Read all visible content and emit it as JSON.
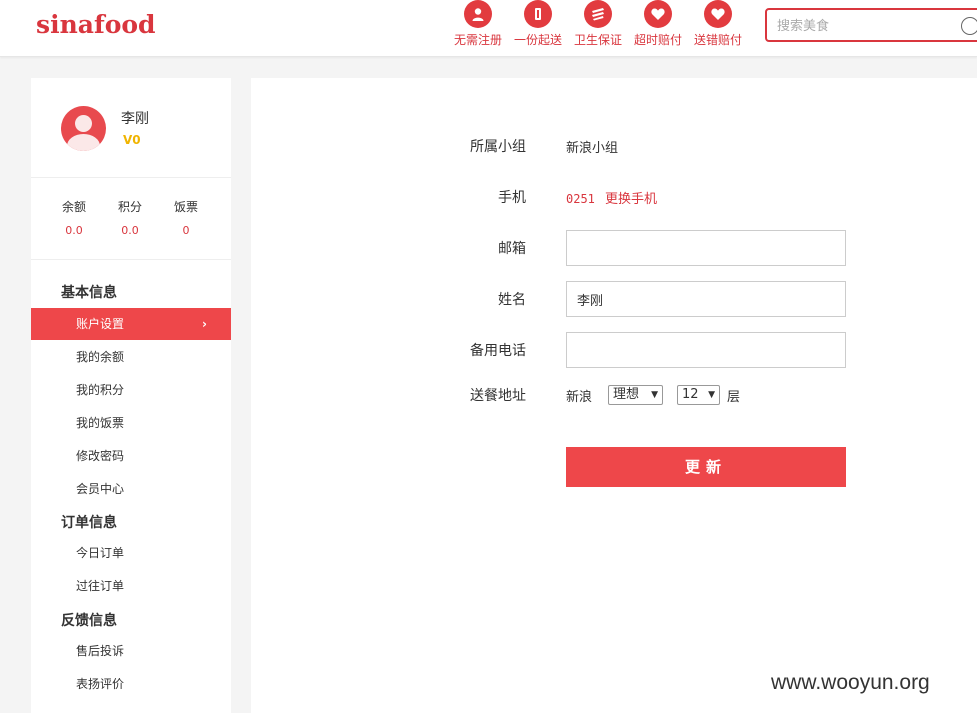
{
  "header": {
    "logo": "sinafood",
    "features": [
      {
        "label": "无需注册",
        "icon": "user-icon"
      },
      {
        "label": "一份起送",
        "icon": "number-one-icon"
      },
      {
        "label": "卫生保证",
        "icon": "hygiene-icon"
      },
      {
        "label": "超时赔付",
        "icon": "heart-icon"
      },
      {
        "label": "送错赔付",
        "icon": "heart-icon"
      }
    ],
    "search": {
      "placeholder": "搜索美食",
      "icon": "search-icon"
    }
  },
  "sidebar": {
    "user": {
      "name": "李刚",
      "vip": "V0"
    },
    "stats": [
      {
        "label": "余额",
        "value": "0.0"
      },
      {
        "label": "积分",
        "value": "0.0"
      },
      {
        "label": "饭票",
        "value": "0"
      }
    ],
    "groups": [
      {
        "title": "基本信息",
        "items": [
          "账户设置",
          "我的余额",
          "我的积分",
          "我的饭票",
          "修改密码",
          "会员中心"
        ]
      },
      {
        "title": "订单信息",
        "items": [
          "今日订单",
          "过往订单"
        ]
      },
      {
        "title": "反馈信息",
        "items": [
          "售后投诉",
          "表扬评价"
        ]
      }
    ],
    "active_arrow": "›"
  },
  "form": {
    "group_label": "所属小组",
    "group_value": "新浪小组",
    "phone_label": "手机",
    "phone_number": "0251",
    "phone_change": "更换手机",
    "email_label": "邮箱",
    "email_value": "",
    "name_label": "姓名",
    "name_value": "李刚",
    "backup_phone_label": "备用电话",
    "backup_phone_value": "",
    "address_label": "送餐地址",
    "address_prefix": "新浪",
    "building": "理想",
    "floor": "12",
    "floor_suffix": "层",
    "submit": "更新"
  },
  "watermark": "www.wooyun.org",
  "colors": {
    "accent": "#ee474a",
    "brand": "#d9363e",
    "vip": "#f0b400"
  }
}
